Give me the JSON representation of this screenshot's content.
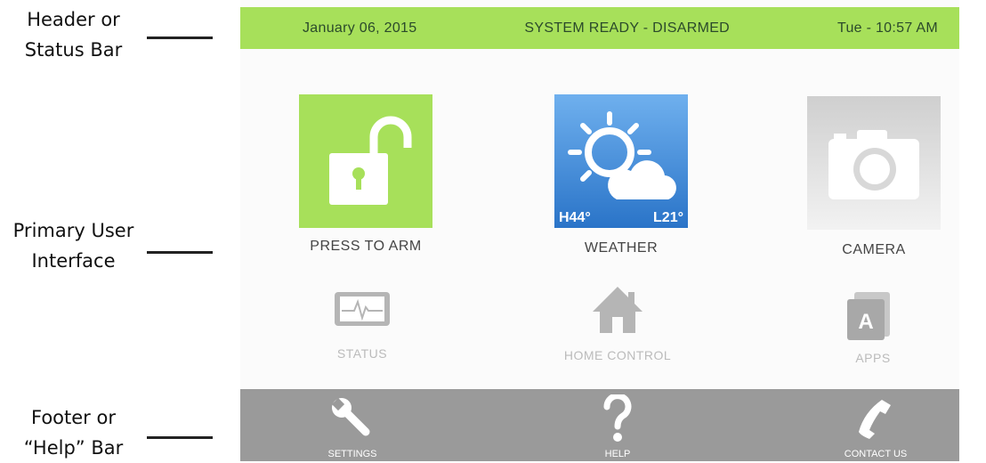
{
  "annotations": {
    "header": [
      "Header or",
      "Status Bar"
    ],
    "primary": [
      "Primary User",
      "Interface"
    ],
    "footer": [
      "Footer or",
      "“Help” Bar"
    ]
  },
  "header": {
    "date": "January 06, 2015",
    "status": "SYSTEM READY - DISARMED",
    "time": "Tue - 10:57 AM",
    "color": "#a7e05a"
  },
  "tiles": {
    "arm": {
      "label": "PRESS TO ARM",
      "icon": "unlocked-padlock-icon",
      "color": "#a7e05a"
    },
    "weather": {
      "label": "WEATHER",
      "icon": "weather-icon",
      "high": "H44°",
      "low": "L21°",
      "color": "#3b86d8"
    },
    "camera": {
      "label": "CAMERA",
      "icon": "camera-icon"
    }
  },
  "secondary": {
    "status": {
      "label": "STATUS",
      "icon": "monitor-heartbeat-icon"
    },
    "home_control": {
      "label": "HOME CONTROL",
      "icon": "house-icon"
    },
    "apps": {
      "label": "APPS",
      "icon": "apps-icon",
      "letter": "A"
    }
  },
  "footer": {
    "settings": {
      "label": "SETTINGS",
      "icon": "wrench-icon"
    },
    "help": {
      "label": "HELP",
      "icon": "question-mark-icon"
    },
    "contact": {
      "label": "CONTACT US",
      "icon": "phone-icon"
    },
    "color": "#9a9a9a"
  }
}
